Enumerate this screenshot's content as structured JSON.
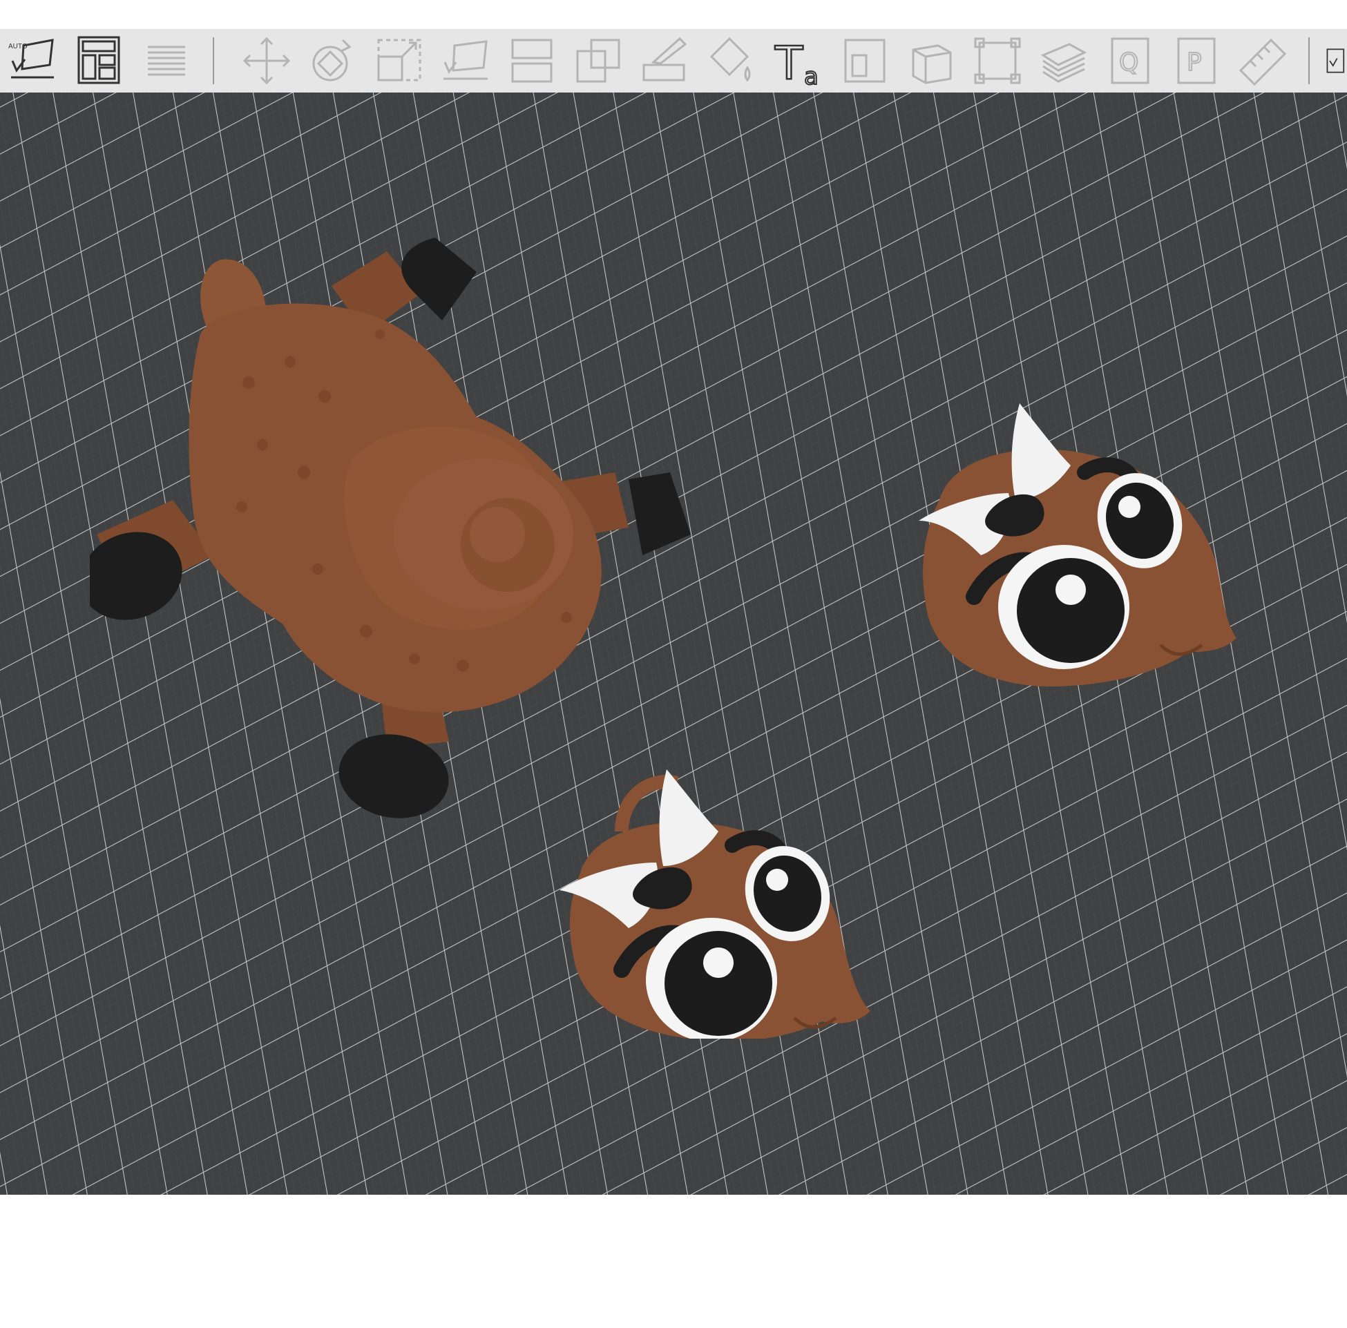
{
  "toolbar": {
    "auto_label": "AUTO",
    "tools": [
      {
        "name": "auto-orient-icon",
        "enabled": true
      },
      {
        "name": "arrange-icon",
        "enabled": true
      },
      {
        "name": "layers-icon",
        "enabled": false
      },
      {
        "name": "move-icon",
        "enabled": false
      },
      {
        "name": "rotate-icon",
        "enabled": false
      },
      {
        "name": "scale-icon",
        "enabled": false
      },
      {
        "name": "lay-on-face-icon",
        "enabled": false
      },
      {
        "name": "split-icon",
        "enabled": false
      },
      {
        "name": "cut-icon",
        "enabled": false
      },
      {
        "name": "support-paint-icon",
        "enabled": false
      },
      {
        "name": "color-paint-icon",
        "enabled": false
      },
      {
        "name": "text-icon",
        "enabled": true
      },
      {
        "name": "emboss-icon",
        "enabled": false
      },
      {
        "name": "assembly-icon",
        "enabled": false
      },
      {
        "name": "measure-box-icon",
        "enabled": false
      },
      {
        "name": "fill-icon",
        "enabled": false
      },
      {
        "name": "q-icon",
        "enabled": false
      },
      {
        "name": "p-icon",
        "enabled": false
      },
      {
        "name": "ruler-icon",
        "enabled": false
      }
    ],
    "text_tool_label": "T",
    "text_tool_sub": "a",
    "q_label": "Q",
    "p_label": "P"
  },
  "colors": {
    "toolbar_bg": "#e6e6e6",
    "viewport_bg": "#3f4142",
    "grid_line": "#c8c8c8",
    "model_body": "#8a5234",
    "hoof": "#1e1e1e",
    "horn": "#f2f2f2"
  },
  "scene": {
    "models": [
      "goat-body-model",
      "goat-head-model-1",
      "goat-head-model-2"
    ]
  }
}
